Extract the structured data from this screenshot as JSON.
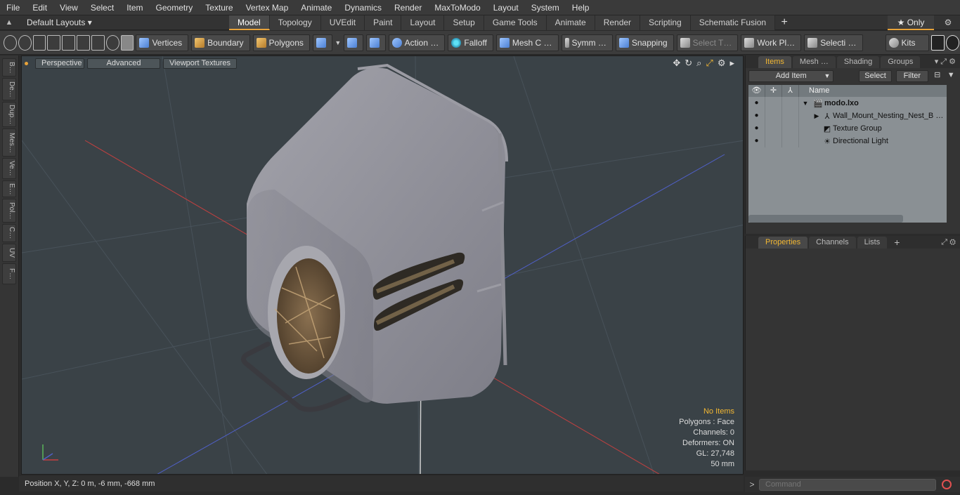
{
  "menu": [
    "File",
    "Edit",
    "View",
    "Select",
    "Item",
    "Geometry",
    "Texture",
    "Vertex Map",
    "Animate",
    "Dynamics",
    "Render",
    "MaxToModo",
    "Layout",
    "System",
    "Help"
  ],
  "layout": {
    "selector": "Default Layouts ▾",
    "tabs": [
      "Model",
      "Topology",
      "UVEdit",
      "Paint",
      "Layout",
      "Setup",
      "Game Tools",
      "Animate",
      "Render",
      "Scripting",
      "Schematic Fusion"
    ],
    "active_tab": "Model",
    "only_label": "★ Only"
  },
  "toolbar": {
    "vertices": "Vertices",
    "boundary": "Boundary",
    "polygons": "Polygons",
    "action": "Action …",
    "falloff": "Falloff",
    "meshc": "Mesh C …",
    "symm": "Symm …",
    "snapping": "Snapping",
    "selectt": "Select T…",
    "workpl": "Work Pl…",
    "selecti": "Selecti …",
    "kits": "Kits"
  },
  "left_strip": [
    "B…",
    "De…",
    "Dup…",
    "Mes…",
    "Ve…",
    "E…",
    "Pol…",
    "C…",
    "UV",
    "F…"
  ],
  "viewport": {
    "perspective": "Perspective",
    "advanced": "Advanced",
    "viewport_textures": "Viewport Textures",
    "info": {
      "no_items": "No Items",
      "polygons": "Polygons : Face",
      "channels": "Channels: 0",
      "deformers": "Deformers: ON",
      "gl": "GL: 27,748",
      "scale": "50 mm"
    }
  },
  "status": {
    "position": "Position X, Y, Z:   0 m, -6 mm, -668 mm"
  },
  "items_panel": {
    "tabs": [
      "Items",
      "Mesh …",
      "Shading",
      "Groups"
    ],
    "active_tab": "Items",
    "add_item": "Add Item",
    "select": "Select",
    "filter": "Filter",
    "name_header": "Name",
    "rows": [
      {
        "label": "modo.lxo",
        "bold": true
      },
      {
        "label": "Wall_Mount_Nesting_Nest_B …",
        "bold": false
      },
      {
        "label": "Texture Group",
        "bold": false
      },
      {
        "label": "Directional Light",
        "bold": false
      }
    ]
  },
  "properties_panel": {
    "tabs": [
      "Properties",
      "Channels",
      "Lists"
    ],
    "active_tab": "Properties"
  },
  "command": {
    "prompt": ">",
    "placeholder": "Command"
  },
  "colors": {
    "accent": "#e8a33a",
    "viewport_bg": "#3a4247",
    "warn": "#f2b733"
  }
}
